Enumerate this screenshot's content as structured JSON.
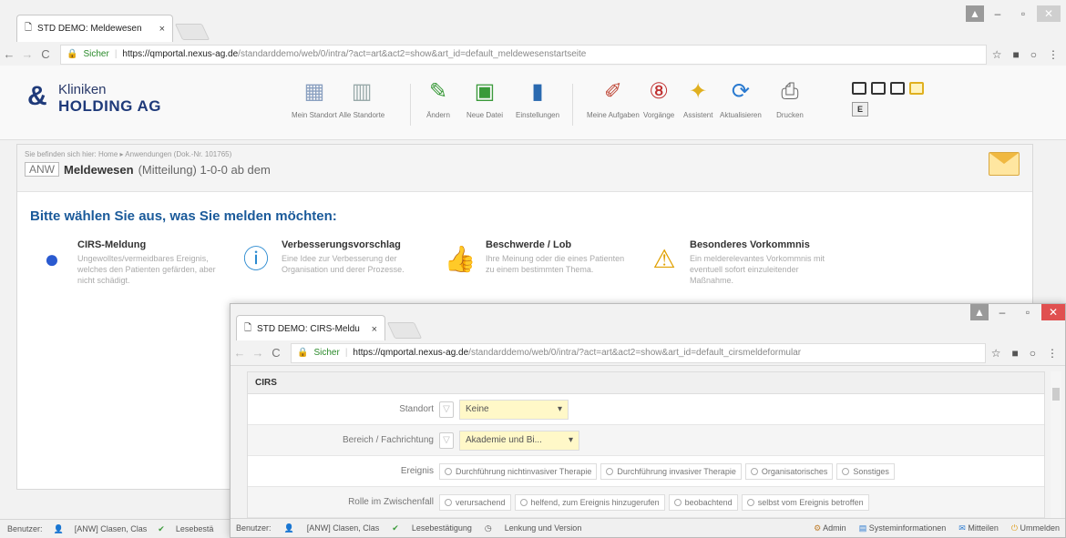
{
  "w1": {
    "tab_title": "STD DEMO: Meldewesen",
    "tab_close": "×",
    "secure_label": "Sicher",
    "url_host": "https://qmportal.nexus-ag.de",
    "url_path": "/standarddemo/web/0/intra/?act=art&act2=show&art_id=default_meldewesenstartseite",
    "logo_line1": "Kliniken",
    "logo_line2": "HOLDING AG",
    "toolbar": [
      {
        "label": "Mein Standort",
        "icon": "building-icon"
      },
      {
        "label": "Alle Standorte",
        "icon": "buildings-icon"
      },
      {
        "label": "Ändern",
        "icon": "pencil-icon"
      },
      {
        "label": "Neue Datei",
        "icon": "monitor-download-icon"
      },
      {
        "label": "Einstellungen",
        "icon": "settings-icon"
      },
      {
        "label": "Meine Aufgaben",
        "icon": "tasks-icon"
      },
      {
        "label": "Vorgänge",
        "icon": "processes-icon"
      },
      {
        "label": "Assistent",
        "icon": "wand-icon"
      },
      {
        "label": "Aktualisieren",
        "icon": "refresh-icon"
      },
      {
        "label": "Drucken",
        "icon": "printer-icon"
      }
    ],
    "e_button": "E",
    "breadcrumb": "Sie befinden sich hier:  Home ▸ Anwendungen (Dok.-Nr. 101765)",
    "doc_prefix": "ANW",
    "doc_title": "Meldewesen",
    "doc_sub": "(Mitteilung)  1-0-0 ab dem",
    "question": "Bitte wählen Sie aus, was Sie melden möchten:",
    "options": [
      {
        "title": "CIRS-Meldung",
        "desc": "Ungewolltes/vermeidbares Ereignis, welches den Patienten gefärden, aber nicht schädigt."
      },
      {
        "title": "Verbesserungsvorschlag",
        "desc": "Eine Idee zur Verbesserung der Organisation und derer Prozesse."
      },
      {
        "title": "Beschwerde / Lob",
        "desc": "Ihre Meinung oder die eines Patienten zu einem bestimmten Thema."
      },
      {
        "title": "Besonderes Vorkommnis",
        "desc": "Ein melderelevantes Vorkommnis mit eventuell sofort einzuleitender Maßnahme."
      }
    ],
    "status_user": "Benutzer:",
    "status_name": "[ANW] Clasen, Clas",
    "status_read": "Lesebestä"
  },
  "w2": {
    "tab_title": "STD DEMO: CIRS-Meldu",
    "tab_close": "×",
    "secure_label": "Sicher",
    "url_host": "https://qmportal.nexus-ag.de",
    "url_path": "/standarddemo/web/0/intra/?act=art&act2=show&art_id=default_cirsmeldeformular",
    "section": "CIRS",
    "standort_label": "Standort",
    "standort_value": "Keine",
    "bereich_label": "Bereich / Fachrichtung",
    "bereich_value": "Akademie und Bi...",
    "ereignis_label": "Ereignis",
    "ereignis_options": [
      "Durchführung nichtinvasiver Therapie",
      "Durchführung invasiver Therapie",
      "Organisatorisches",
      "Sonstiges"
    ],
    "rolle_label": "Rolle im Zwischenfall",
    "rolle_options": [
      "verursachend",
      "helfend, zum Ereignis hinzugerufen",
      "beobachtend",
      "selbst vom Ereignis betroffen"
    ],
    "status_user": "Benutzer:",
    "status_name": "[ANW] Clasen, Clas",
    "status_read": "Lesebestätigung",
    "status_lenkung": "Lenkung und Version",
    "status_admin": "Admin",
    "status_sysinfo": "Systeminformationen",
    "status_mitteilen": "Mitteilen",
    "status_ummelden": "Ummelden"
  }
}
